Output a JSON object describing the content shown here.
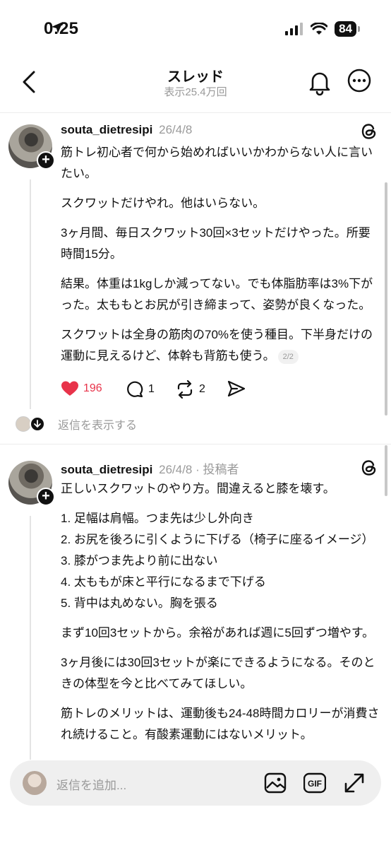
{
  "status_bar": {
    "time": "0:25",
    "battery": "84"
  },
  "nav": {
    "title": "スレッド",
    "subtitle": "表示25.4万回"
  },
  "posts": [
    {
      "username": "souta_dietresipi",
      "date": "26/4/8",
      "badge": "",
      "paragraphs": [
        "筋トレ初心者で何から始めればいいかわからない人に言いたい。",
        "スクワットだけやれ。他はいらない。",
        "3ヶ月間、毎日スクワット30回×3セットだけやった。所要時間15分。",
        "結果。体重は1kgしか減ってない。でも体脂肪率は3%下がった。太ももとお尻が引き締まって、姿勢が良くなった。",
        "スクワットは全身の筋肉の70%を使う種目。下半身だけの運動に見えるけど、体幹も背筋も使う。"
      ],
      "page_indicator": "2/2",
      "likes": "196",
      "comments": "1",
      "reposts": "2"
    },
    {
      "username": "souta_dietresipi",
      "date": "26/4/8",
      "badge": "· 投稿者",
      "intro": "正しいスクワットのやり方。間違えると膝を壊す。",
      "list": [
        "1. 足幅は肩幅。つま先は少し外向き",
        "2. お尻を後ろに引くように下げる（椅子に座るイメージ）",
        "3. 膝がつま先より前に出ない",
        "4. 太ももが床と平行になるまで下げる",
        "5. 背中は丸めない。胸を張る"
      ],
      "paragraphs": [
        "まず10回3セットから。余裕があれば週に5回ずつ増やす。",
        "3ヶ月後には30回3セットが楽にできるようになる。そのときの体型を今と比べてみてほしい。",
        "筋トレのメリットは、運動後も24-48時間カロリーが消費され続けること。有酸素運動にはないメリット。"
      ]
    }
  ],
  "show_replies": "返信を表示する",
  "reply_bar": {
    "placeholder": "返信を追加..."
  },
  "icons": {
    "back": "chevron-left-icon",
    "bell": "bell-icon",
    "more": "more-icon",
    "threads": "threads-logo-icon",
    "like": "heart-icon",
    "comment": "comment-icon",
    "repost": "repost-icon",
    "share": "share-icon",
    "image": "image-icon",
    "gif": "gif-icon",
    "expand": "expand-icon"
  },
  "colors": {
    "like": "#e8334a",
    "muted": "#999999",
    "text": "#111111"
  }
}
